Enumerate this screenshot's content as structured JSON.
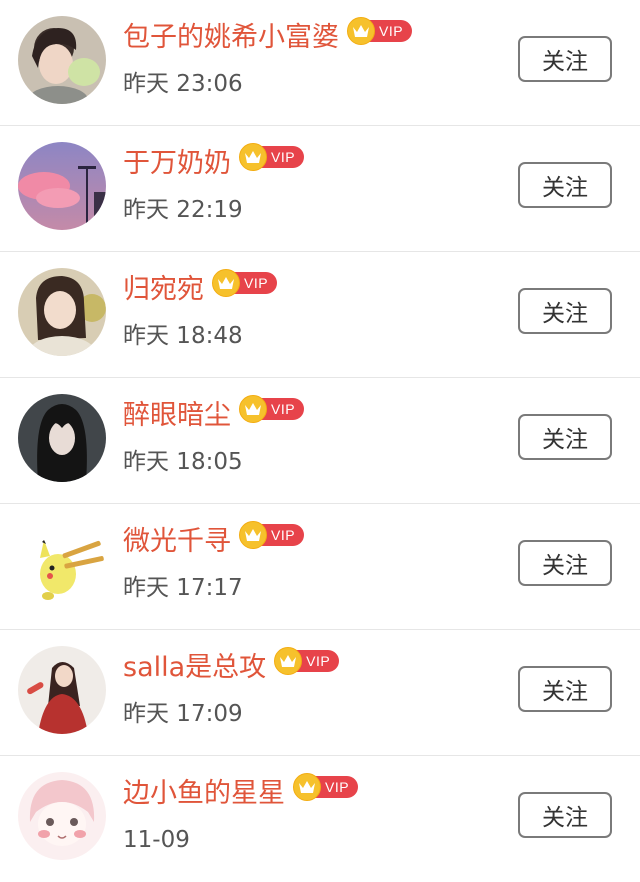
{
  "follow_list": {
    "items": [
      {
        "name": "包子的姚希小富婆",
        "time": "昨天 23:06",
        "vip": "VIP",
        "follow_label": "关注"
      },
      {
        "name": "于万奶奶",
        "time": "昨天 22:19",
        "vip": "VIP",
        "follow_label": "关注"
      },
      {
        "name": "归宛宛",
        "time": "昨天 18:48",
        "vip": "VIP",
        "follow_label": "关注"
      },
      {
        "name": "醉眼暗尘",
        "time": "昨天 18:05",
        "vip": "VIP",
        "follow_label": "关注"
      },
      {
        "name": "微光千寻",
        "time": "昨天 17:17",
        "vip": "VIP",
        "follow_label": "关注"
      },
      {
        "name": "salla是总攻",
        "time": "昨天 17:09",
        "vip": "VIP",
        "follow_label": "关注"
      },
      {
        "name": "边小鱼的星星",
        "time": "11-09",
        "vip": "VIP",
        "follow_label": "关注"
      }
    ]
  },
  "colors": {
    "name": "#e0553a",
    "vip_badge": "#e7434a",
    "vip_crown": "#f6c12c"
  }
}
